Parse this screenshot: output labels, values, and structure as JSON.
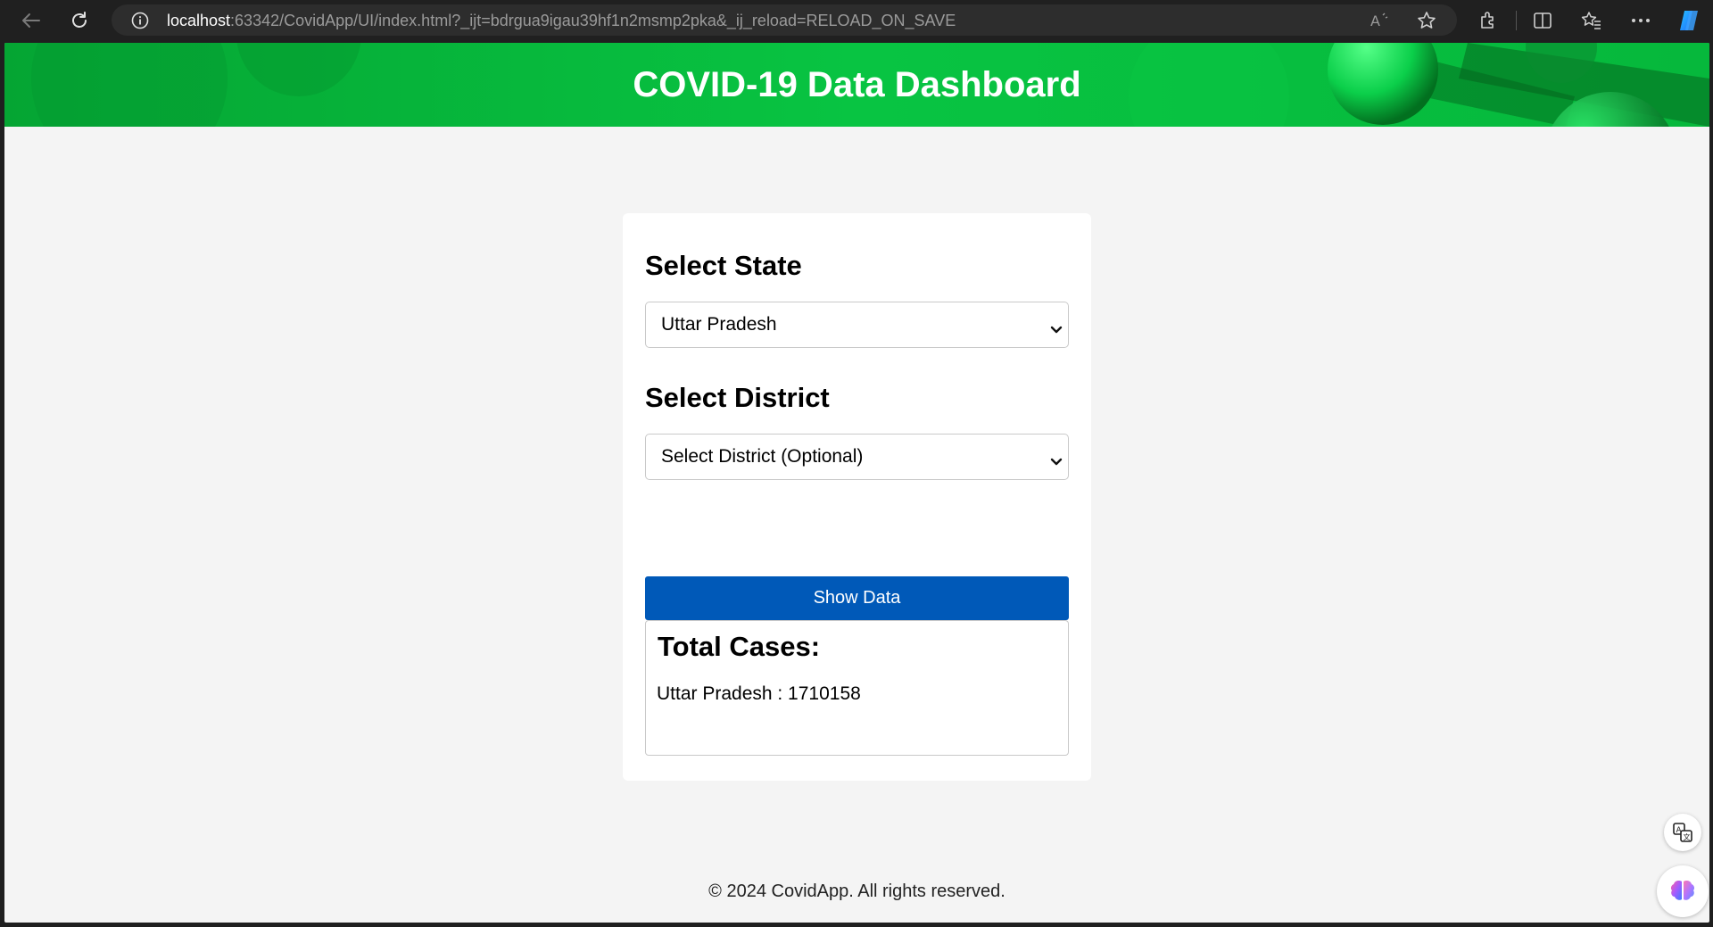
{
  "browser": {
    "url_host": "localhost",
    "url_rest": ":63342/CovidApp/UI/index.html?_ijt=bdrgua9igau39hf1n2msmp2pka&_ij_reload=RELOAD_ON_SAVE",
    "icons": [
      "back-icon",
      "refresh-icon",
      "site-info-icon",
      "read-aloud-icon",
      "favorite-star-icon",
      "extensions-icon",
      "split-screen-icon",
      "favorites-icon",
      "more-icon",
      "copilot-icon"
    ]
  },
  "header": {
    "title": "COVID-19 Data Dashboard",
    "bg_color": "#06b83c"
  },
  "form": {
    "state_heading": "Select State",
    "state_value": "Uttar Pradesh",
    "district_heading": "Select District",
    "district_value": "Select District (Optional)",
    "show_button": "Show Data",
    "button_color": "#0059b8"
  },
  "result": {
    "title": "Total Cases:",
    "line": "Uttar Pradesh : 1710158"
  },
  "footer": {
    "text": "© 2024 CovidApp. All rights reserved."
  },
  "floating": {
    "icons": [
      "translate-icon",
      "brain-icon"
    ]
  }
}
